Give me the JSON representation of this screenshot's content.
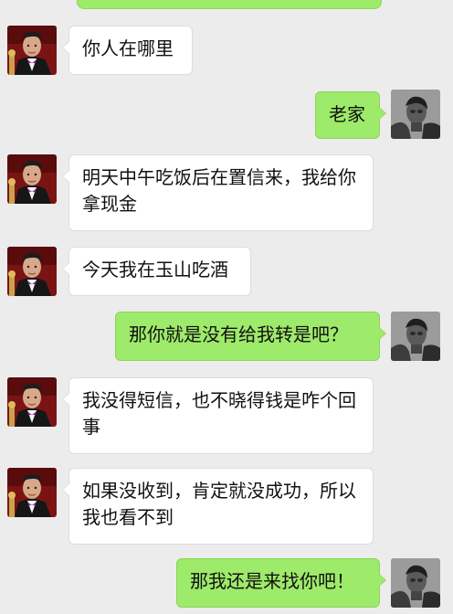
{
  "chat": {
    "theme": {
      "background": "#ececec",
      "sent_bubble": "#9eea6a",
      "received_bubble": "#ffffff"
    },
    "contact_avatar_icon": "man-in-suit-avatar-icon",
    "self_avatar_icon": "grayscale-portrait-avatar-icon",
    "messages": [
      {
        "side": "left",
        "text": "你人在哪里"
      },
      {
        "side": "right",
        "text": "老家"
      },
      {
        "side": "left",
        "text": "明天中午吃饭后在置信来，我给你拿现金"
      },
      {
        "side": "left",
        "text": "今天我在玉山吃酒"
      },
      {
        "side": "right",
        "text": "那你就是没有给我转是吧？"
      },
      {
        "side": "left",
        "text": "我没得短信，也不晓得钱是咋个回事"
      },
      {
        "side": "left",
        "text": "如果没收到，肯定就没成功，所以我也看不到"
      },
      {
        "side": "right",
        "text": "那我还是来找你吧！"
      }
    ]
  }
}
